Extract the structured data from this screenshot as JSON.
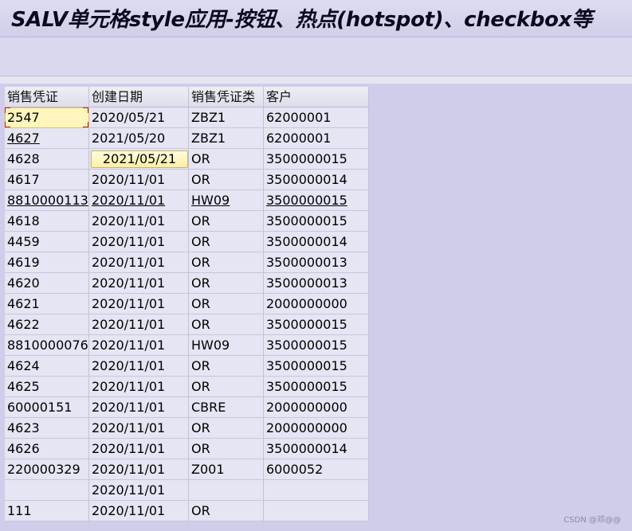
{
  "window": {
    "title": "SALV单元格style应用-按钮、热点(hotspot)、checkbox等"
  },
  "table": {
    "columns": [
      "销售凭证",
      "创建日期",
      "销售凭证类",
      "客户"
    ],
    "rows": [
      {
        "vbeln": "2547",
        "erdat": "2020/05/21",
        "auart": "ZBZ1",
        "kunnr": "62000001"
      },
      {
        "vbeln": "4627",
        "erdat": "2021/05/20",
        "auart": "ZBZ1",
        "kunnr": "62000001"
      },
      {
        "vbeln": "4628",
        "erdat": "2021/05/21",
        "auart": "OR",
        "kunnr": "3500000015"
      },
      {
        "vbeln": "4617",
        "erdat": "2020/11/01",
        "auart": "OR",
        "kunnr": "3500000014"
      },
      {
        "vbeln": "8810000113",
        "erdat": "2020/11/01",
        "auart": "HW09",
        "kunnr": "3500000015"
      },
      {
        "vbeln": "4618",
        "erdat": "2020/11/01",
        "auart": "OR",
        "kunnr": "3500000015"
      },
      {
        "vbeln": "4459",
        "erdat": "2020/11/01",
        "auart": "OR",
        "kunnr": "3500000014"
      },
      {
        "vbeln": "4619",
        "erdat": "2020/11/01",
        "auart": "OR",
        "kunnr": "3500000013"
      },
      {
        "vbeln": "4620",
        "erdat": "2020/11/01",
        "auart": "OR",
        "kunnr": "3500000013"
      },
      {
        "vbeln": "4621",
        "erdat": "2020/11/01",
        "auart": "OR",
        "kunnr": "2000000000"
      },
      {
        "vbeln": "4622",
        "erdat": "2020/11/01",
        "auart": "OR",
        "kunnr": "3500000015"
      },
      {
        "vbeln": "8810000076",
        "erdat": "2020/11/01",
        "auart": "HW09",
        "kunnr": "3500000015"
      },
      {
        "vbeln": "4624",
        "erdat": "2020/11/01",
        "auart": "OR",
        "kunnr": "3500000015"
      },
      {
        "vbeln": "4625",
        "erdat": "2020/11/01",
        "auart": "OR",
        "kunnr": "3500000015"
      },
      {
        "vbeln": "60000151",
        "erdat": "2020/11/01",
        "auart": "CBRE",
        "kunnr": "2000000000"
      },
      {
        "vbeln": "4623",
        "erdat": "2020/11/01",
        "auart": "OR",
        "kunnr": "2000000000"
      },
      {
        "vbeln": "4626",
        "erdat": "2020/11/01",
        "auart": "OR",
        "kunnr": "3500000014"
      },
      {
        "vbeln": "220000329",
        "erdat": "2020/11/01",
        "auart": "Z001",
        "kunnr": "6000052"
      },
      {
        "vbeln": "",
        "erdat": "2020/11/01",
        "auart": "",
        "kunnr": ""
      },
      {
        "vbeln": "111",
        "erdat": "2020/11/01",
        "auart": "OR",
        "kunnr": ""
      }
    ]
  },
  "watermark": "CSDN @邓@@"
}
